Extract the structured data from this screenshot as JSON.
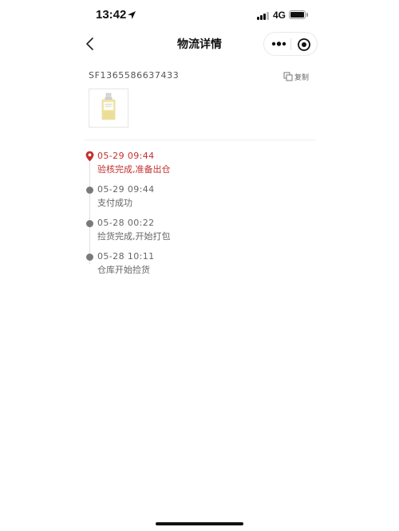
{
  "status_bar": {
    "time": "13:42",
    "network": "4G",
    "icons": [
      "location-arrow-icon",
      "signal-bars-icon",
      "battery-icon"
    ]
  },
  "nav": {
    "title": "物流详情",
    "icons": [
      "back-chevron-icon",
      "more-dots-icon",
      "close-target-icon"
    ]
  },
  "tracking": {
    "number": "SF1365586637433",
    "copy_label": "复制",
    "copy_icon": "copy-icon"
  },
  "colors": {
    "accent": "#c2302f",
    "dot_gray": "#7a7a7a",
    "text_gray": "#666666"
  },
  "timeline": [
    {
      "time": "05-29 09:44",
      "desc": "验核完成,准备出仓",
      "active": true,
      "icon": "location-pin-icon"
    },
    {
      "time": "05-29 09:44",
      "desc": "支付成功",
      "active": false,
      "icon": "dot-icon"
    },
    {
      "time": "05-28 00:22",
      "desc": "捡货完成,开始打包",
      "active": false,
      "icon": "dot-icon"
    },
    {
      "time": "05-28 10:11",
      "desc": "仓库开始捡货",
      "active": false,
      "icon": "dot-icon"
    }
  ]
}
